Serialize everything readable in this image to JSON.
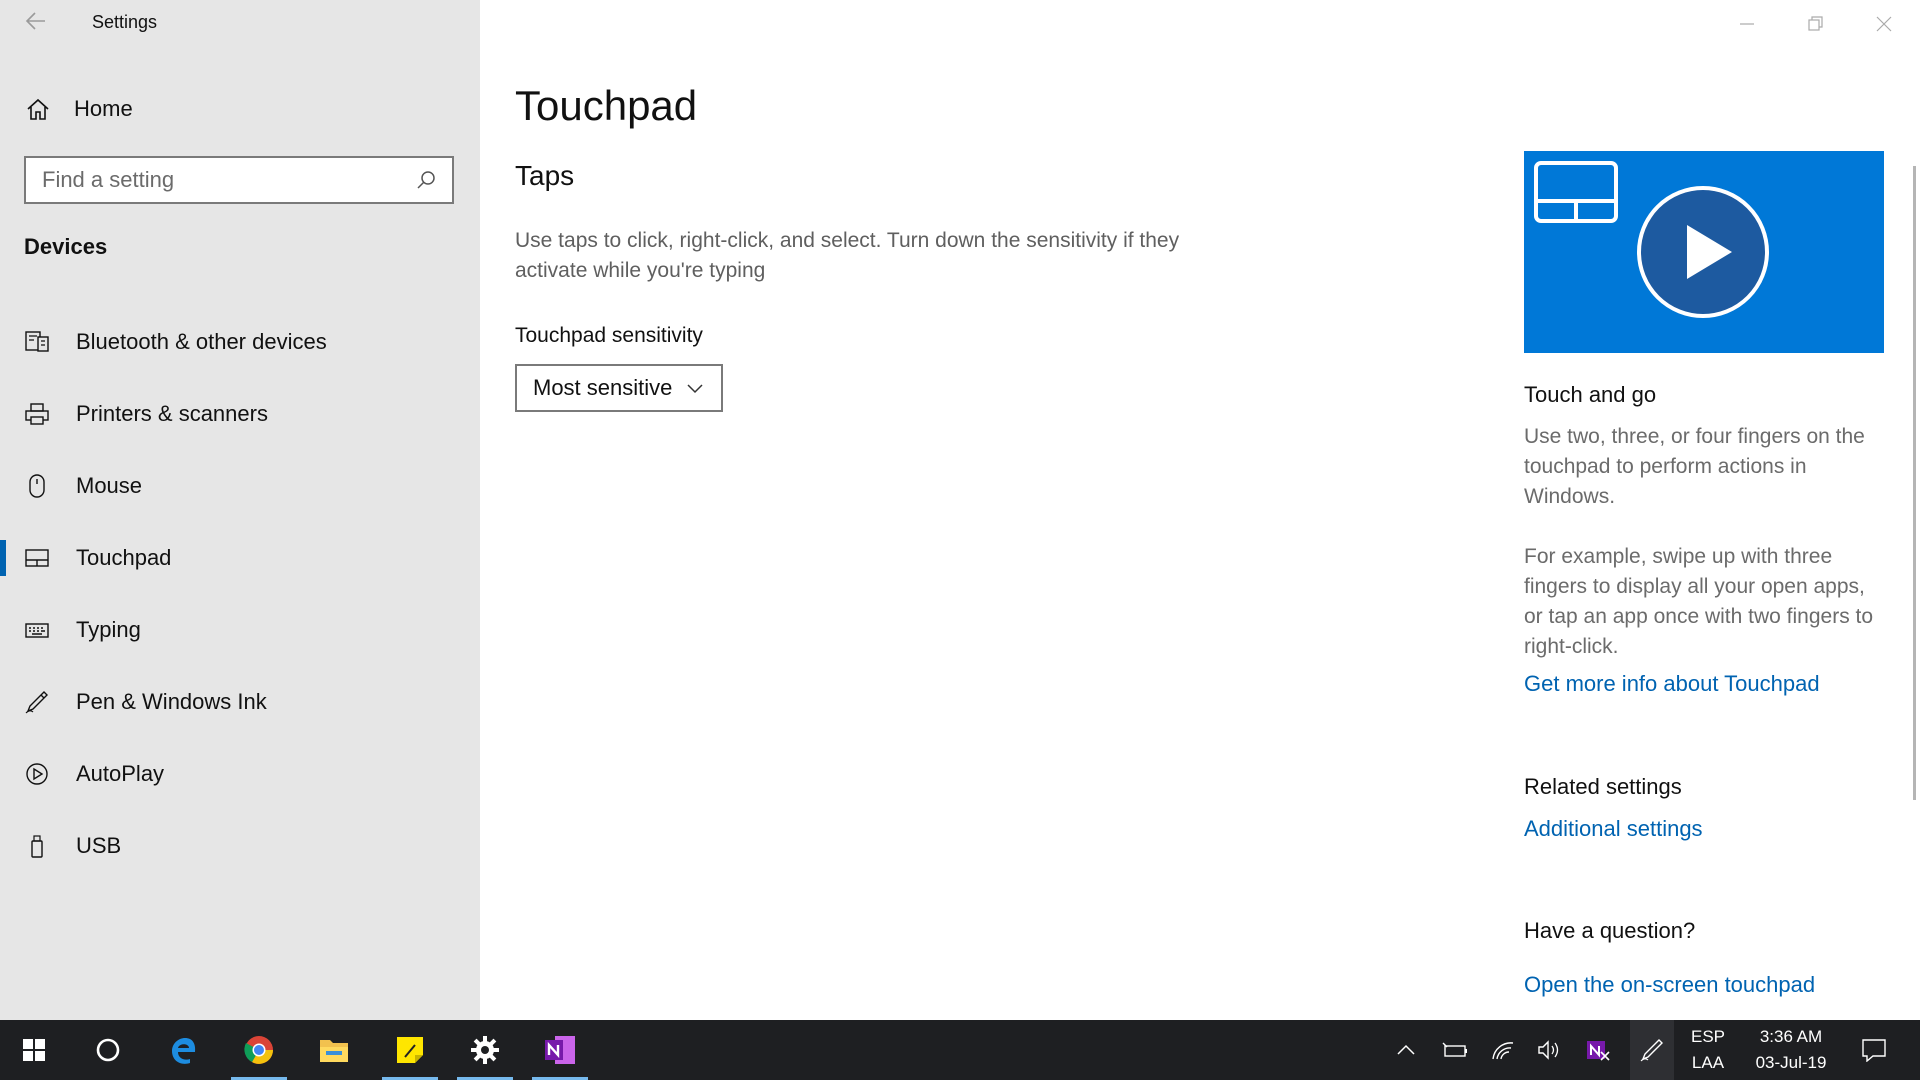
{
  "window": {
    "app_title": "Settings"
  },
  "sidebar": {
    "home_label": "Home",
    "search_placeholder": "Find a setting",
    "section_label": "Devices",
    "items": [
      {
        "label": "Bluetooth & other devices",
        "icon": "bluetooth-devices-icon"
      },
      {
        "label": "Printers & scanners",
        "icon": "printer-icon"
      },
      {
        "label": "Mouse",
        "icon": "mouse-icon"
      },
      {
        "label": "Touchpad",
        "icon": "touchpad-icon",
        "active": true
      },
      {
        "label": "Typing",
        "icon": "keyboard-icon"
      },
      {
        "label": "Pen & Windows Ink",
        "icon": "pen-icon"
      },
      {
        "label": "AutoPlay",
        "icon": "autoplay-icon"
      },
      {
        "label": "USB",
        "icon": "usb-icon"
      }
    ]
  },
  "main": {
    "title": "Touchpad",
    "section_title": "Taps",
    "description": "Use taps to click, right-click, and select. Turn down the sensitivity if they activate while you're typing",
    "sensitivity_label": "Touchpad sensitivity",
    "sensitivity_value": "Most sensitive"
  },
  "right_panel": {
    "video_heading": "Touch and go",
    "text1": "Use two, three, or four fingers on the touchpad to perform actions in Windows.",
    "text2": "For example, swipe up with three fingers to display all your open apps, or tap an app once with two fingers to right-click.",
    "link_more_info": "Get more info about Touchpad",
    "related_heading": "Related settings",
    "link_additional": "Additional settings",
    "question_heading": "Have a question?",
    "link_onscreen": "Open the on-screen touchpad"
  },
  "taskbar": {
    "apps": [
      "start",
      "cortana",
      "edge",
      "chrome",
      "file-explorer",
      "sticky-notes",
      "settings",
      "onenote"
    ],
    "language_line1": "ESP",
    "language_line2": "LAA",
    "time": "3:36 AM",
    "date": "03-Jul-19"
  },
  "colors": {
    "accent": "#0078d7",
    "link": "#0063b1",
    "sidebar_bg": "#e6e6e6",
    "taskbar_bg": "#1e1f22"
  }
}
